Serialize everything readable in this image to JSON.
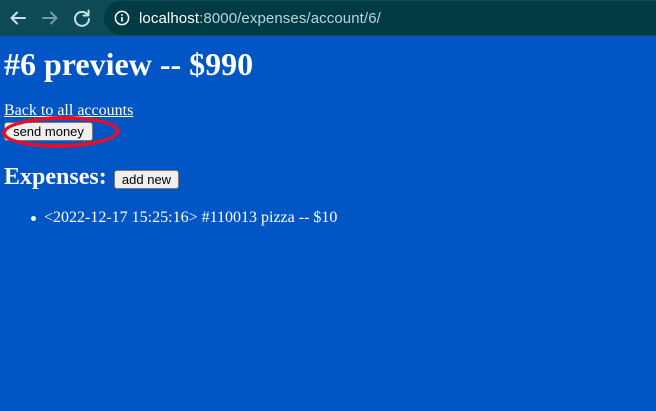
{
  "browser": {
    "url_host": "localhost",
    "url_path": ":8000/expenses/account/6/",
    "icons": [
      "back-arrow-icon",
      "forward-arrow-icon",
      "reload-icon",
      "info-icon"
    ]
  },
  "page": {
    "title": "#6 preview -- $990",
    "back_link": "Back to all accounts",
    "send_money_label": "send money",
    "expenses_heading": "Expenses:",
    "add_new_label": "add new",
    "expenses": [
      {
        "text": "<2022-12-17 15:25:16> #110013 pizza -- $10"
      }
    ]
  },
  "annotation": {
    "highlight_color": "#e3102a"
  },
  "colors": {
    "page_background": "#0255c4",
    "chrome_background": "#0d4a55"
  }
}
